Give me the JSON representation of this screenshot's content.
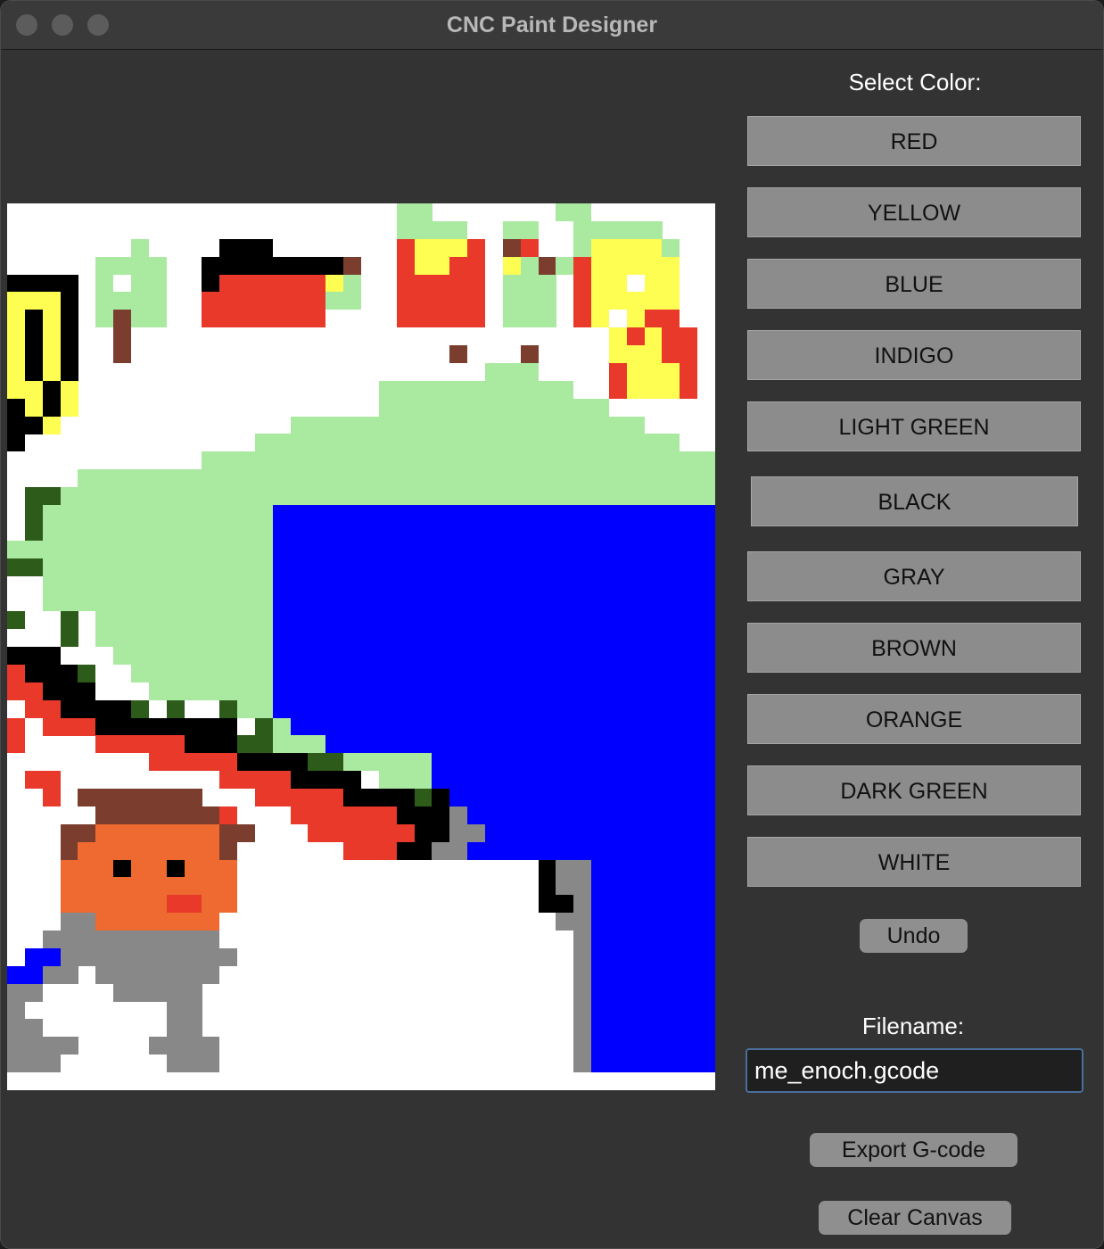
{
  "window": {
    "title": "CNC Paint Designer"
  },
  "panel": {
    "select_color_label": "Select Color:",
    "colors": [
      "RED",
      "YELLOW",
      "BLUE",
      "INDIGO",
      "LIGHT GREEN",
      "BLACK",
      "GRAY",
      "BROWN",
      "ORANGE",
      "DARK GREEN",
      "WHITE"
    ],
    "undo_label": "Undo",
    "filename_label": "Filename:",
    "filename_value": "me_enoch.gcode",
    "export_label": "Export G-code",
    "clear_label": "Clear Canvas"
  },
  "palette": {
    "R": "#e8392a",
    "Y": "#fdfd52",
    "U": "#0000ff",
    "L": "#aaeaa0",
    "K": "#000000",
    "G": "#888888",
    "N": "#7a3d2e",
    "O": "#ee6a30",
    "D": "#2d5b1a",
    "W": "#ffffff"
  },
  "grid": {
    "cols": 40,
    "rows": 50,
    "pixels": [
      "......................LL.......LL.......",
      "......................LLLL..LL..LLLLL...",
      ".......L....KKK.......RYYYR.NR..LYYYYL..",
      ".....LLLL..KKKKKKKKN..RYYRR.YLNLRYYYYY..",
      "KKKK.L.LL..KRRRRRRYL..RRRRR.LLL.RYYWYY..",
      "YYYK.LLLL..RRRRRRRLL..RRRRR.LLL.RYYYYY..",
      "YKYK.LNLL..RRRRRRR....RRRRR.LLL.RYWYRR..",
      "YKYK..N...........................YRYRR.",
      "YKYK..N..................N...N....YYYRR.",
      "YKYK.......................LLL....RYYYR.",
      "YYKY.................LLLLLLLLLLL..RYYYR.",
      "KYKY.................LLLLLLLLLLLLL.......",
      "KKY.............LLLLLLLLLLLLLLLLLLLL......",
      "K.............LLLLLLLLLLLLLLLLLLLLLLLL....",
      "...........LLLLLLLLLLLLLLLLLLLLLLLLLLLLL",
      "....LLLLLLLLLLLLLLLLLLLLLLLLLLLLLLLLLLLL",
      ".DDLLLLLLLLLLLLLLLLLLLLLLLLLLLLLLLLLLLLL",
      ".DLLLLLLLLLLLLLUUUUUUUUUUUUUUUUUUUUUUUUU",
      ".DLLLLLLLLLLLLLUUUUUUUUUUUUUUUUUUUUUUUUU",
      "LLLLLLLLLLLLLLLUUUUUUUUUUUUUUUUUUUUUUUUU",
      "DDLLLLLLLLLLLLLUUUUUUUUUUUUUUUUUUUUUUUUU",
      "..LLLLLLLLLLLLLUUUUUUUUUUUUUUUUUUUUUUUUU",
      "..LLLLLLLLLLLLLUUUUUUUUUUUUUUUUUUUUUUUUU",
      "D..D.LLLLLLLLLLUUUUUUUUUUUUUUUUUUUUUUUUU",
      "...D.LLLLLLLLLLUUUUUUUUUUUUUUUUUUUUUUUUU",
      "KKK...LLLLLLLLLUUUUUUUUUUUUUUUUUUUUUUUUU",
      "RKKKD..LLLLLLLLUUUUUUUUUUUUUUUUUUUUUUUUU",
      "RRKKK...LLLLLLLUUUUUUUUUUUUUUUUUUUUUUUUU",
      ".RRKKKKD.D..DLLUUUUUUUUUUUUUUUUUUUUUUUUU",
      "R.RRRKKKKKKKK.DLUUUUUUUUUUUUUUUUUUUUUUUU",
      "R....RRRRRKKKDDLLLUUUUUUUUUUUUUUUUUUUUUU",
      "........RRRRRKKKKDDLLLLLUUUUUUUUUUUUUUUU",
      ".RR.........RRRRKKKK.LLLUUUUUUUUUUUUUUUU",
      "..R.NNNNNNN...RRRRRKKKKDKUUUUUUUUUUUUUUU",
      ".....NNNNNNNR...RRRRRRKKKGUUUUUUUUUUUUUU",
      "...NNOOOOOOONN...RRRRRRKKGGUUUUUUUUUUUUU",
      "...NOOOOOOOON......RRRKKGGUUUUUUUUUUUUUU",
      "...OOOKOOKOOO.................KGGUUUUUUU",
      "...OOOOOOOOOO.................KGGUUUUUUU",
      "...OOOOOORROO.................KKGUUUUUUU",
      "...GGOOOOOOO...................GGUUUUUUU",
      "..GGGGGGGGGG....................GUUUUUUU",
      ".UUGGGGGGGGGG...................GUUUUUUU",
      "UUGG.GGGGGGG....................GUUUUUUU",
      "GG....GGGGG.....................GUUUUUUU",
      "G........GG.....................GUUUUUUU",
      "GG.......GG.....................GUUUUUUU",
      "GGGG....GGGG....................GUUUUUUU",
      "GGG......GGG....................GUUUUUUU",
      "........................................"
    ]
  }
}
